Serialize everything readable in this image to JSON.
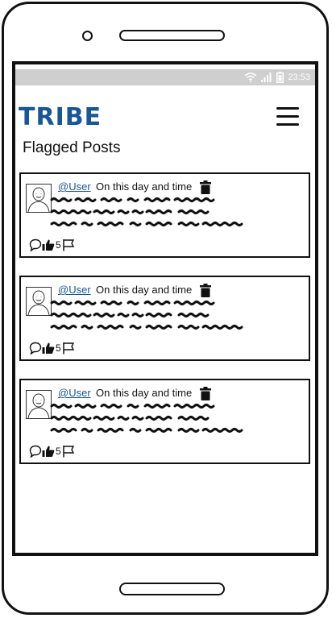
{
  "status_bar": {
    "time": "23:53",
    "icons": [
      "wifi-icon",
      "signal-icon",
      "battery-icon"
    ]
  },
  "header": {
    "app_name": "TRIBE",
    "menu_icon": "hamburger-menu-icon"
  },
  "page": {
    "title": "Flagged Posts"
  },
  "posts": [
    {
      "user": "@User",
      "timestamp": "On this day and time",
      "likes": "5"
    },
    {
      "user": "@User",
      "timestamp": "On this day and time",
      "likes": "5"
    },
    {
      "user": "@User",
      "timestamp": "On this day and time",
      "likes": "5"
    }
  ],
  "colors": {
    "brand": "#1a5594",
    "status_bar": "#cfcfcf",
    "frame": "#111111"
  }
}
